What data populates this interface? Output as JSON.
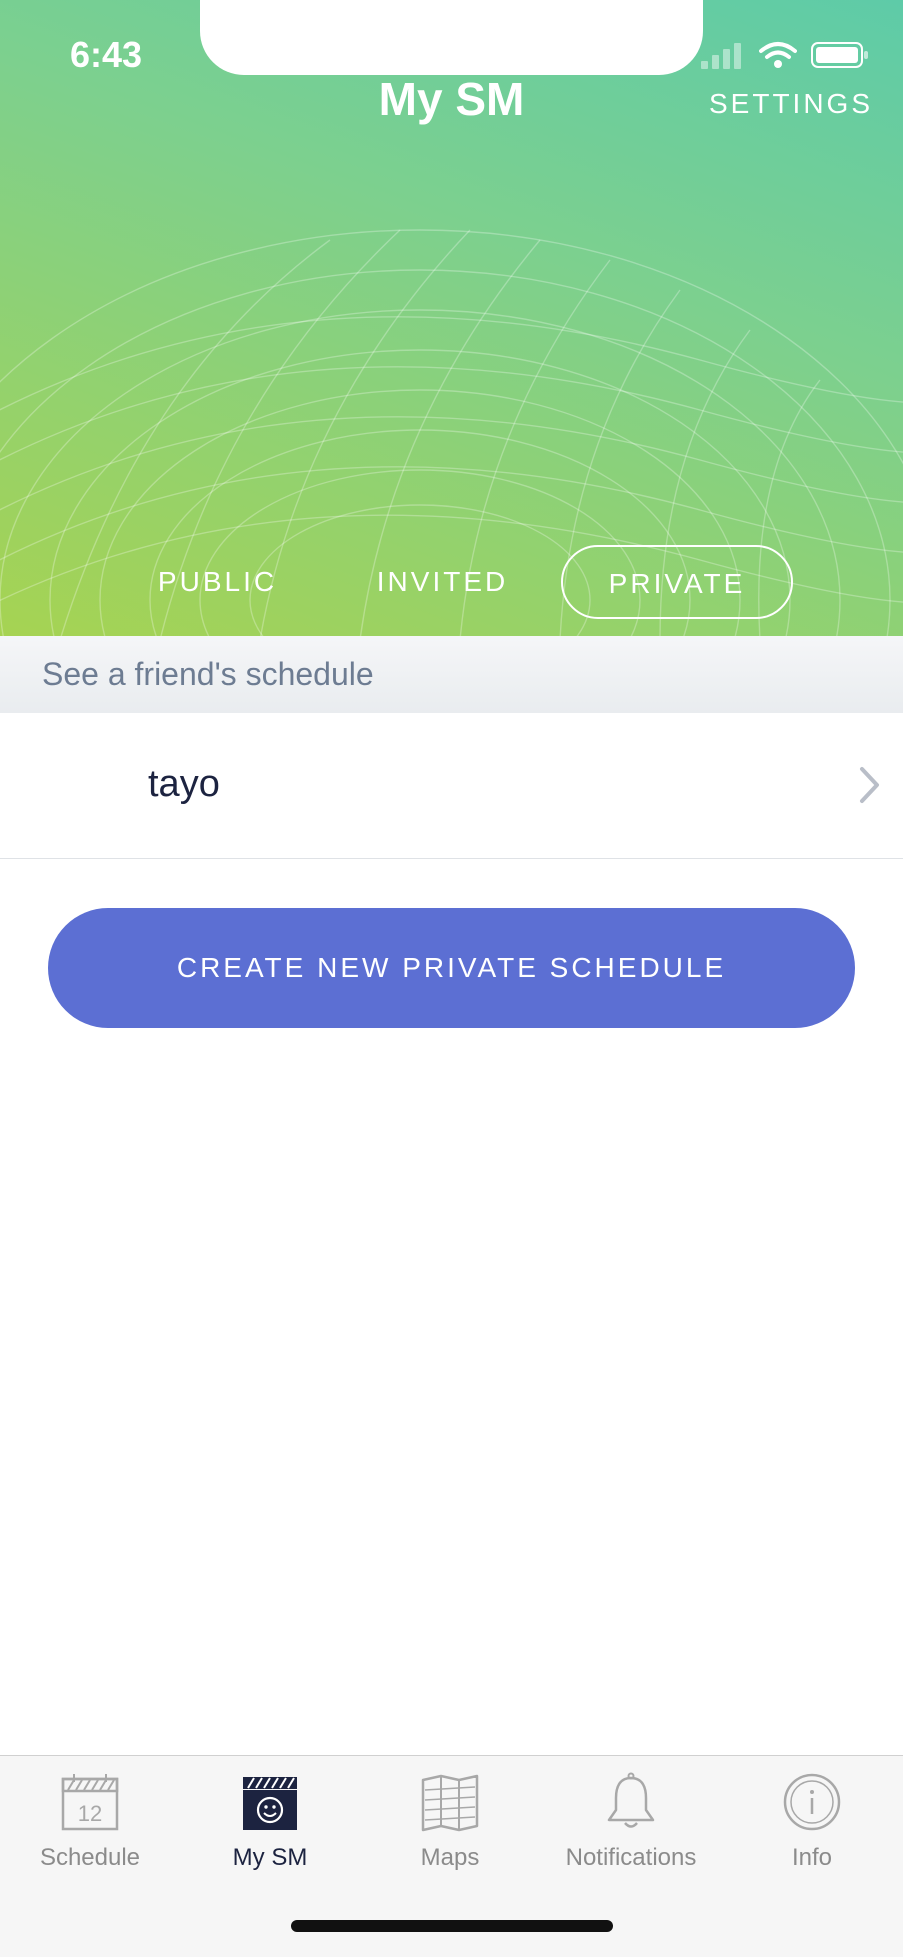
{
  "status_bar": {
    "time": "6:43"
  },
  "header": {
    "title": "My SM",
    "settings_label": "SETTINGS"
  },
  "segments": {
    "public": "PUBLIC",
    "invited": "INVITED",
    "private": "PRIVATE",
    "selected": "PRIVATE"
  },
  "section": {
    "title": "See a friend's schedule"
  },
  "schedules": [
    {
      "name": "tayo"
    }
  ],
  "cta": {
    "label": "CREATE NEW PRIVATE SCHEDULE"
  },
  "tabbar": {
    "tabs": [
      {
        "label": "Schedule",
        "icon": "calendar-icon",
        "calendar_day": "12"
      },
      {
        "label": "My SM",
        "icon": "my-schedule-icon",
        "active": true
      },
      {
        "label": "Maps",
        "icon": "map-icon"
      },
      {
        "label": "Notifications",
        "icon": "bell-icon"
      },
      {
        "label": "Info",
        "icon": "info-icon"
      }
    ]
  },
  "colors": {
    "header_gradient_start": "#5ecba8",
    "header_gradient_end": "#a6d352",
    "cta": "#5c6fd3",
    "active_tab": "#1c2340"
  }
}
